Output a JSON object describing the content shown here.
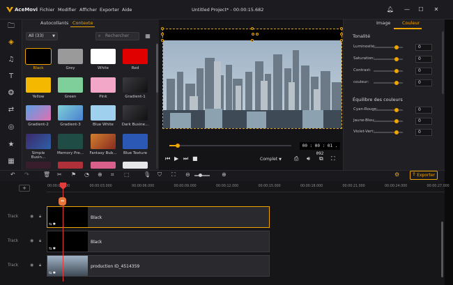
{
  "app": {
    "name": "AceMovi",
    "window_title": "Untitled Project* - 00:00:15.682",
    "menu": [
      "Fichier",
      "Modifier",
      "Afficher",
      "Exporter",
      "Aide"
    ]
  },
  "library": {
    "tabs": [
      "Autocollants",
      "Contexte"
    ],
    "active_tab": "Contexte",
    "filter_value": "All (33)",
    "search_placeholder": "Rechercher",
    "tiles": [
      {
        "label": "Black",
        "color": "#000000",
        "selected": true
      },
      {
        "label": "Grey",
        "color": "#9a9a9a"
      },
      {
        "label": "White",
        "color": "#ffffff"
      },
      {
        "label": "Red",
        "color": "#e00000"
      },
      {
        "label": "Yellow",
        "color": "#f5b800"
      },
      {
        "label": "Green",
        "color": "#7fcf9a"
      },
      {
        "label": "Pink",
        "color": "#f2a7c8"
      },
      {
        "label": "Gradient-1",
        "color": "#2a2a2e"
      },
      {
        "label": "Gradient-2",
        "color": "#e06fb0"
      },
      {
        "label": "Gradient-3",
        "color": "#7fd0d8"
      },
      {
        "label": "Blue White",
        "color": "#9fd0ee"
      },
      {
        "label": "Dark Busine...",
        "color": "#1c1c20"
      },
      {
        "label": "Simple Busin...",
        "color": "#2f3e7a"
      },
      {
        "label": "Memory Pre...",
        "color": "#1f4d46"
      },
      {
        "label": "Fantasy Bub...",
        "color": "#c06020"
      },
      {
        "label": "Blue Texture",
        "color": "#2b57b5"
      }
    ]
  },
  "preview": {
    "timecode": "00 : 00 : 01 . 092",
    "quality": "Complet"
  },
  "properties": {
    "tabs": [
      "Image",
      "Couleur"
    ],
    "active_tab": "Couleur",
    "tonality_title": "Tonalité",
    "tonality": [
      {
        "label": "Luminosité:",
        "value": "0"
      },
      {
        "label": "Saturation:",
        "value": "0"
      },
      {
        "label": "Contrast:",
        "value": "0"
      },
      {
        "label": "couleur:",
        "value": "0"
      }
    ],
    "balance_title": "Équilibre des couleurs",
    "balance": [
      {
        "label": "Cyan-Rouge:",
        "value": "0"
      },
      {
        "label": "Jaune-Bleu:",
        "value": "0"
      },
      {
        "label": "Violet-Vert:",
        "value": "0"
      }
    ]
  },
  "toolbar": {
    "export_label": "Exporter"
  },
  "timeline": {
    "ruler": [
      "00:00:00.000",
      "00:00:03.000",
      "00:00:06.000",
      "00:00:09.000",
      "00:00:12.000",
      "00:00:15.000",
      "00:00:18.000",
      "00:00:21.000",
      "00:00:24.000",
      "00:00:27.000"
    ],
    "tracks": [
      {
        "label": "Track",
        "clip": "Black"
      },
      {
        "label": "Track",
        "clip": "Black"
      },
      {
        "label": "Track",
        "clip": "production ID_4514359"
      }
    ]
  },
  "colors": {
    "accent": "#f0a500",
    "playhead": "#e23b3b"
  }
}
